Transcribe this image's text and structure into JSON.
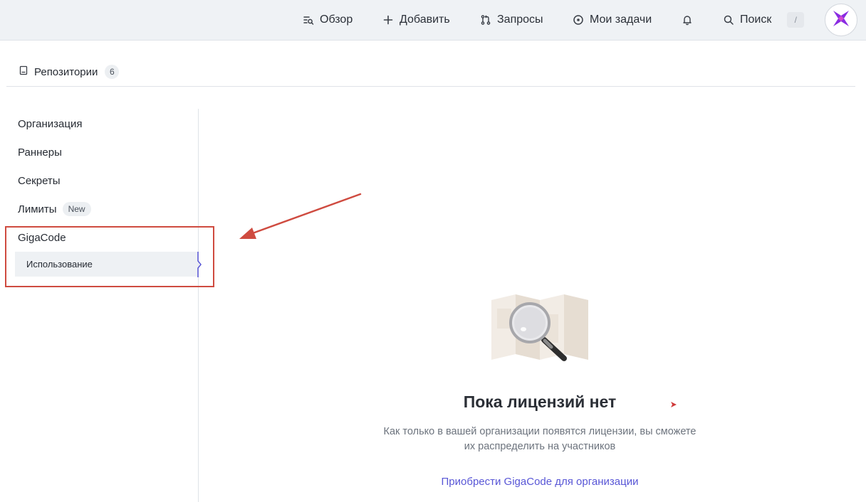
{
  "topbar": {
    "overview_label": "Обзор",
    "add_label": "Добавить",
    "requests_label": "Запросы",
    "tasks_label": "Мои задачи",
    "search_label": "Поиск",
    "search_shortcut": "/"
  },
  "repos": {
    "label": "Репозитории",
    "count": "6"
  },
  "sidebar": {
    "items": [
      {
        "label": "Организация"
      },
      {
        "label": "Раннеры"
      },
      {
        "label": "Секреты"
      },
      {
        "label": "Лимиты",
        "badge": "New"
      },
      {
        "label": "GigaCode"
      }
    ],
    "sub_item_label": "Использование"
  },
  "empty_state": {
    "title": "Пока лицензий нет",
    "description": "Как только в вашей организации появятся лицензии, вы сможете их распределить на участников",
    "link": "Приобрести GigaCode для организации"
  },
  "colors": {
    "accent": "#5856d6",
    "annotation": "#cf4b40",
    "topbar_bg": "#eff2f5"
  },
  "icons": [
    "overview-icon",
    "plus-icon",
    "pull-request-icon",
    "task-icon",
    "bell-icon",
    "search-icon",
    "repo-icon",
    "gigacode-logo-icon",
    "map-search-illustration"
  ]
}
